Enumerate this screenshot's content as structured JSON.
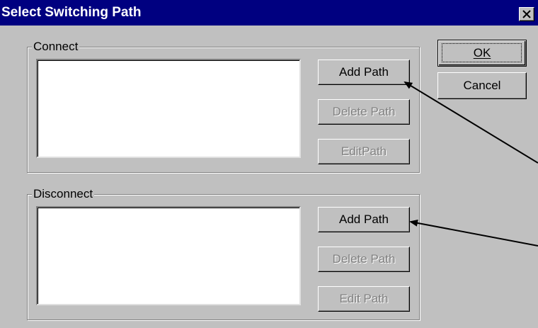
{
  "window": {
    "title": "Select Switching Path",
    "close_glyph": "×"
  },
  "connect": {
    "label": "Connect",
    "add_path": "Add Path",
    "delete_path": "Delete Path",
    "edit_path": "EditPath"
  },
  "disconnect": {
    "label": "Disconnect",
    "add_path": "Add Path",
    "delete_path": "Delete Path",
    "edit_path": "Edit Path"
  },
  "actions": {
    "ok_label": "OK",
    "cancel_label": "Cancel"
  },
  "colors": {
    "titlebar": "#000080",
    "dialog_bg": "#c0c0c0",
    "disabled_text": "#808080"
  },
  "icons": {
    "close": "close-icon",
    "annotation": "arrow-icon"
  }
}
